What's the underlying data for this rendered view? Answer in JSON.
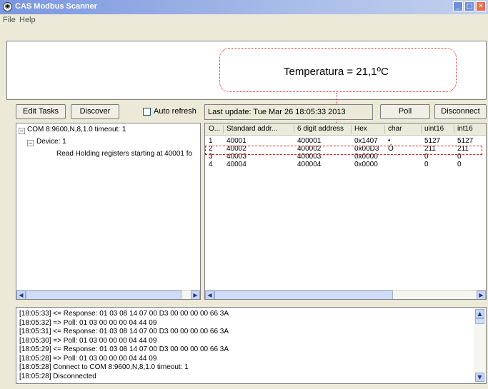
{
  "window": {
    "title": "CAS Modbus Scanner"
  },
  "menu": [
    "File",
    "Help"
  ],
  "display": {
    "text": "Temperatura = 21,1ºC"
  },
  "toolbar": {
    "edit_tasks": "Edit Tasks",
    "discover": "Discover",
    "auto_refresh_label": "Auto refresh",
    "auto_refresh_checked": false,
    "status": "Last update: Tue Mar 26 18:05:33 2013",
    "poll": "Poll",
    "disconnect": "Disconnect"
  },
  "tree": {
    "root": "COM 8:9600,N,8,1.0 timeout: 1",
    "device": "Device: 1",
    "task": "Read Holding registers starting at 40001 fo"
  },
  "table": {
    "columns": [
      "O...",
      "Standard addr...",
      "6 digit address",
      "Hex",
      "char",
      "uint16",
      "int16"
    ],
    "rows": [
      [
        "1",
        "40001",
        "400001",
        "0x1407",
        "•",
        "5127",
        "5127"
      ],
      [
        "2",
        "40002",
        "400002",
        "0x00D3",
        "Ó",
        "211",
        "211"
      ],
      [
        "3",
        "40003",
        "400003",
        "0x0000",
        "",
        "0",
        "0"
      ],
      [
        "4",
        "40004",
        "400004",
        "0x0000",
        "",
        "0",
        "0"
      ]
    ]
  },
  "log": [
    "[18:05:33] <= Response: 01 03 08 14 07 00 D3 00 00 00 00 66 3A",
    "[18:05:32] => Poll: 01 03 00 00 00 04 44 09",
    "[18:05:31] <= Response: 01 03 08 14 07 00 D3 00 00 00 00 66 3A",
    "[18:05:30] => Poll: 01 03 00 00 00 04 44 09",
    "[18:05:29] <= Response: 01 03 08 14 07 00 D3 00 00 00 00 66 3A",
    "[18:05:28] => Poll: 01 03 00 00 00 04 44 09",
    "[18:05:28] Connect to COM 8:9600,N,8,1.0 timeout: 1",
    "[18:05:28] Disconnected"
  ],
  "icons": [
    "app-icon",
    "minimize-icon",
    "maximize-icon",
    "close-icon",
    "collapse-icon",
    "scroll-left-icon",
    "scroll-right-icon",
    "scroll-up-icon",
    "scroll-down-icon"
  ],
  "colors": {
    "callout": "#dd2222",
    "titlebar": "#7a96df",
    "window_bg": "#ece9d8"
  }
}
